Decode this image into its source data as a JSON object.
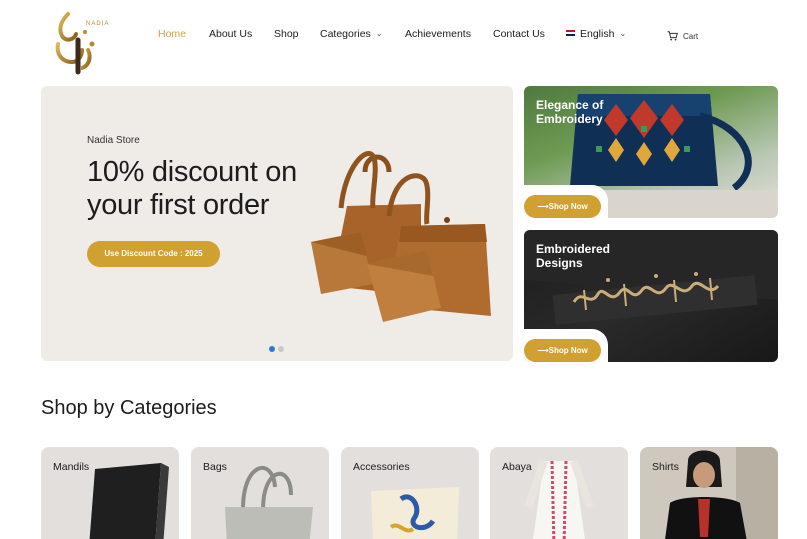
{
  "brand": {
    "logo_text": "NADIA"
  },
  "nav": {
    "items": [
      {
        "label": "Home",
        "active": true
      },
      {
        "label": "About Us"
      },
      {
        "label": "Shop"
      },
      {
        "label": "Categories",
        "has_dropdown": true
      },
      {
        "label": "Achievements"
      },
      {
        "label": "Contact Us"
      }
    ],
    "language": {
      "label": "English",
      "icon": "uk-flag-icon"
    },
    "cart": {
      "label": "Cart",
      "icon": "cart-icon"
    }
  },
  "hero": {
    "subtitle": "Nadia Store",
    "title": "10% discount on your first order",
    "button": "Use Discount Code : 2025",
    "slides": 2,
    "active_slide": 1
  },
  "promos": [
    {
      "title": "Elegance of Embroidery",
      "button": "⟶Shop Now"
    },
    {
      "title": "Embroidered Designs",
      "button": "⟶Shop Now"
    }
  ],
  "categories": {
    "title": "Shop by Categories",
    "items": [
      {
        "label": "Mandils"
      },
      {
        "label": "Bags"
      },
      {
        "label": "Accessories"
      },
      {
        "label": "Abaya"
      },
      {
        "label": "Shirts"
      }
    ]
  },
  "colors": {
    "accent": "#d0a030",
    "hero_bg": "#efebe7",
    "card_bg": "#e2dfdc"
  }
}
